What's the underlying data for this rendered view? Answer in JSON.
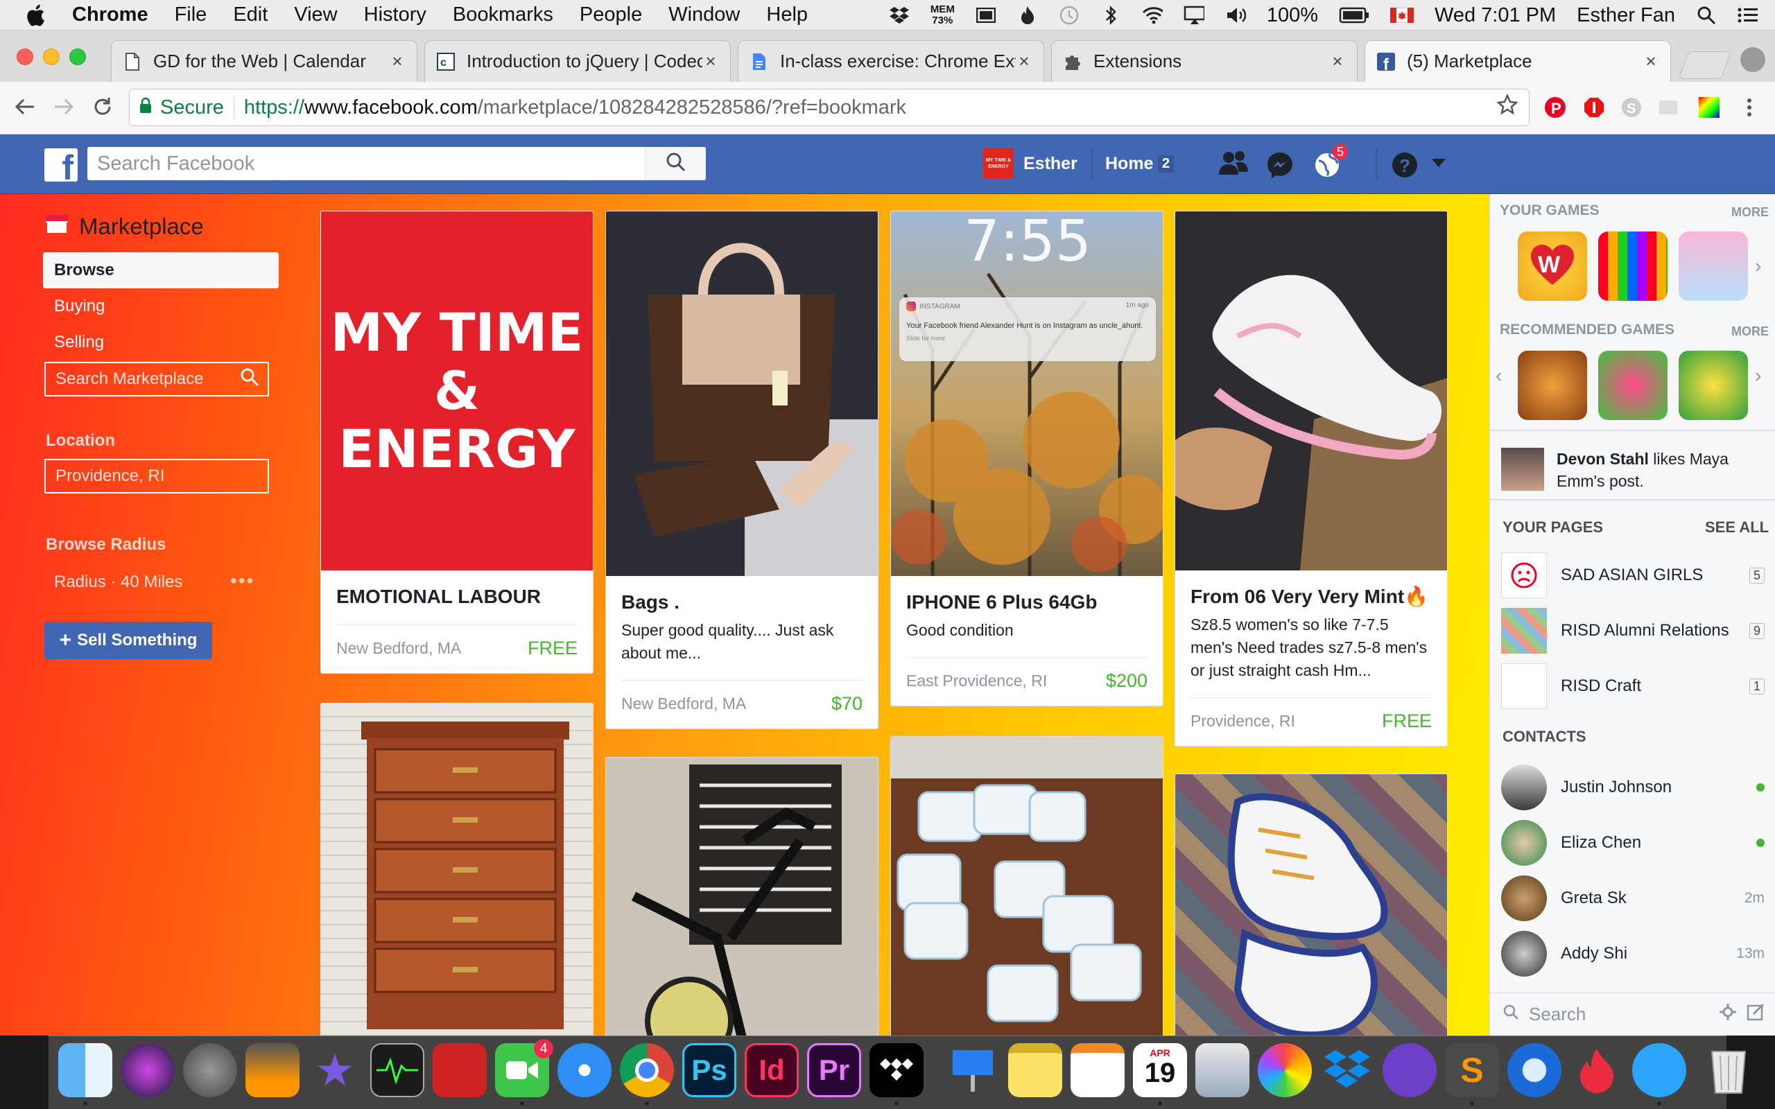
{
  "menubar": {
    "items": [
      "Chrome",
      "File",
      "Edit",
      "View",
      "History",
      "Bookmarks",
      "People",
      "Window",
      "Help"
    ],
    "mem_label": "MEM",
    "mem_value": "73%",
    "battery": "100%",
    "clock": "Wed 7:01 PM",
    "user": "Esther Fan"
  },
  "tabs": [
    {
      "title": "GD for the Web | Calendar",
      "icon": "document-icon"
    },
    {
      "title": "Introduction to jQuery | Codec",
      "icon": "codecademy-icon"
    },
    {
      "title": "In-class exercise: Chrome Exte",
      "icon": "google-docs-icon"
    },
    {
      "title": "Extensions",
      "icon": "puzzle-icon"
    },
    {
      "title": "(5) Marketplace",
      "icon": "facebook-icon"
    }
  ],
  "address": {
    "secure_label": "Secure",
    "protocol": "https://",
    "host": "www.facebook.com",
    "path": "/marketplace/108284282528586/?ref=bookmark"
  },
  "fb": {
    "search_placeholder": "Search Facebook",
    "user_name": "Esther",
    "user_page_badge": "MY TIME & ENERGY",
    "home_label": "Home",
    "home_count": "2",
    "notif_count": "5"
  },
  "marketplace": {
    "title": "Marketplace",
    "nav": [
      "Browse",
      "Buying",
      "Selling"
    ],
    "search_placeholder": "Search Marketplace",
    "location_heading": "Location",
    "location_value": "Providence, RI",
    "radius_heading": "Browse Radius",
    "radius_value": "Radius · 40 Miles",
    "sell_label": "Sell Something"
  },
  "listings": [
    {
      "title": "EMOTIONAL LABOUR",
      "desc": "",
      "location": "New Bedford, MA",
      "price": "FREE",
      "image_text_1": "MY TIME",
      "image_text_2": "& ENERGY"
    },
    {
      "title": "Bags .",
      "desc": "Super good quality.... Just ask about me...",
      "location": "New Bedford, MA",
      "price": "$70"
    },
    {
      "title": "IPHONE 6 Plus 64Gb",
      "desc": "Good condition",
      "location": "East Providence, RI",
      "price": "$200",
      "lock_time": "7:55",
      "notif_app": "INSTAGRAM",
      "notif_age": "1m ago",
      "notif_text": "Your Facebook friend Alexander Hunt is on Instagram as uncle_ahunt.",
      "notif_hint": "Slide for more"
    },
    {
      "title": "From 06 Very Very Mint🔥",
      "desc": "Sz8.5 women's so like 7-7.5 men's Need trades sz7.5-8 men's or just straight cash Hm...",
      "location": "Providence, RI",
      "price": "FREE"
    }
  ],
  "right_sidebar": {
    "games_heading": "YOUR GAMES",
    "more_label": "MORE",
    "recommended_heading": "RECOMMENDED GAMES",
    "activity_name": "Devon Stahl",
    "activity_text": " likes Maya Emm's post.",
    "pages_heading": "YOUR PAGES",
    "see_all": "SEE ALL",
    "pages": [
      {
        "name": "SAD ASIAN GIRLS",
        "count": "5"
      },
      {
        "name": "RISD Alumni Relations",
        "count": "9"
      },
      {
        "name": "RISD Craft",
        "count": "1"
      }
    ],
    "contacts_heading": "CONTACTS",
    "contacts": [
      {
        "name": "Justin Johnson",
        "status": ""
      },
      {
        "name": "Eliza Chen",
        "status": ""
      },
      {
        "name": "Greta Sk",
        "status": "2m"
      },
      {
        "name": "Addy Shi",
        "status": "13m"
      }
    ],
    "chat_search_placeholder": "Search"
  },
  "dock": {
    "apps": [
      "Finder",
      "Siri",
      "System Preferences",
      "Calculator",
      "iMovie",
      "Activity Monitor",
      "Photo Booth",
      "FaceTime",
      "Safari",
      "Chrome",
      "Photoshop",
      "InDesign",
      "Premiere",
      "Tidal",
      "Keynote",
      "Notes",
      "Pages",
      "Calendar",
      "Preview",
      "Photos",
      "Dropbox",
      "GitHub",
      "Sublime Text",
      "QuickTime",
      "Tinder",
      "Messages",
      "Trash"
    ],
    "facetime_badge": "4",
    "calendar_month": "APR",
    "calendar_day": "19"
  },
  "colors": {
    "fb_blue": "#4267b2",
    "price_green": "#42b72a",
    "chrome_secure": "#0b8043"
  }
}
